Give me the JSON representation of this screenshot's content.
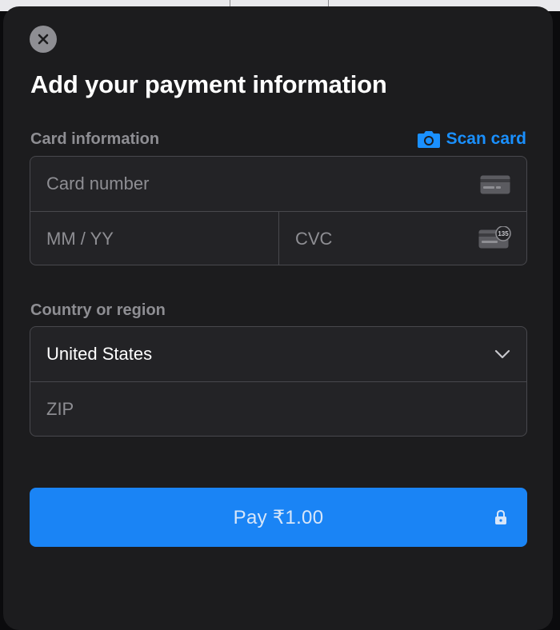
{
  "sheet": {
    "title": "Add your payment information",
    "close_icon": "close-icon"
  },
  "card_section": {
    "label": "Card information",
    "scan_card": {
      "label": "Scan card",
      "icon": "camera-icon"
    },
    "card_number": {
      "placeholder": "Card number",
      "icon": "card-icon"
    },
    "expiry": {
      "placeholder": "MM / YY"
    },
    "cvc": {
      "placeholder": "CVC",
      "icon": "card-cvc-icon",
      "icon_text": "135"
    }
  },
  "address_section": {
    "label": "Country or region",
    "country": {
      "value": "United States",
      "icon": "chevron-down-icon"
    },
    "zip": {
      "placeholder": "ZIP"
    }
  },
  "pay_button": {
    "label": "Pay ₹1.00",
    "icon": "lock-icon"
  },
  "colors": {
    "background": "#1c1c1e",
    "field": "#232326",
    "accent": "#1a84f5",
    "link": "#1a90ff",
    "muted_text": "#8e8e93"
  }
}
